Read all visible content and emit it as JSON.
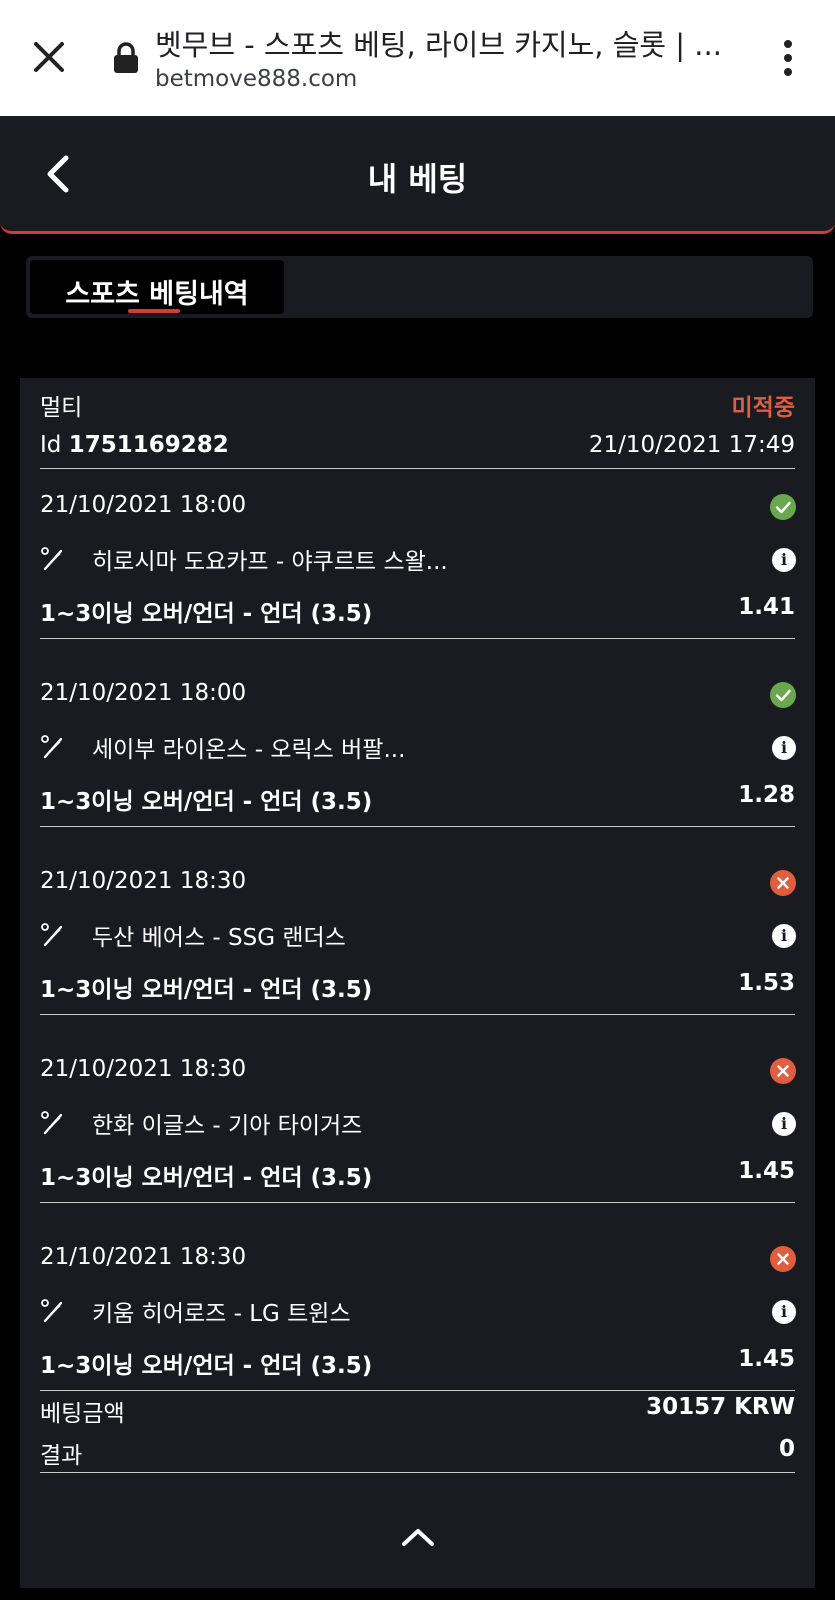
{
  "browser": {
    "title": "벳무브 - 스포츠 베팅, 라이브 카지노, 슬롯 | ...",
    "url": "betmove888.com"
  },
  "header": {
    "title": "내 베팅"
  },
  "tabs": [
    {
      "label": "스포츠 베팅내역",
      "active": true
    }
  ],
  "bet": {
    "type": "멀티",
    "status": "미적중",
    "id_label": "Id",
    "id": "1751169282",
    "placed_at": "21/10/2021 17:49",
    "selections": [
      {
        "date": "21/10/2021 18:00",
        "match": "히로시마 도요카프 - 야쿠르트 스왈...",
        "market": "1~3이닝 오버/언더 - 언더 (3.5)",
        "odds": "1.41",
        "result": "win"
      },
      {
        "date": "21/10/2021 18:00",
        "match": "세이부 라이온스 - 오릭스 버팔...",
        "market": "1~3이닝 오버/언더 - 언더 (3.5)",
        "odds": "1.28",
        "result": "win"
      },
      {
        "date": "21/10/2021 18:30",
        "match": "두산 베어스 - SSG 랜더스",
        "market": "1~3이닝 오버/언더 - 언더 (3.5)",
        "odds": "1.53",
        "result": "lose"
      },
      {
        "date": "21/10/2021 18:30",
        "match": "한화 이글스 - 기아 타이거즈",
        "market": "1~3이닝 오버/언더 - 언더 (3.5)",
        "odds": "1.45",
        "result": "lose"
      },
      {
        "date": "21/10/2021 18:30",
        "match": "키움 히어로즈 - LG 트윈스",
        "market": "1~3이닝 오버/언더 - 언더 (3.5)",
        "odds": "1.45",
        "result": "lose"
      }
    ],
    "stake_label": "베팅금액",
    "stake": "30157 KRW",
    "result_label": "결과",
    "result": "0"
  },
  "colors": {
    "accent": "#d83a34",
    "win": "#6aa84f",
    "lose": "#e05d3d",
    "background": "#000000",
    "card": "#1a1b20"
  }
}
